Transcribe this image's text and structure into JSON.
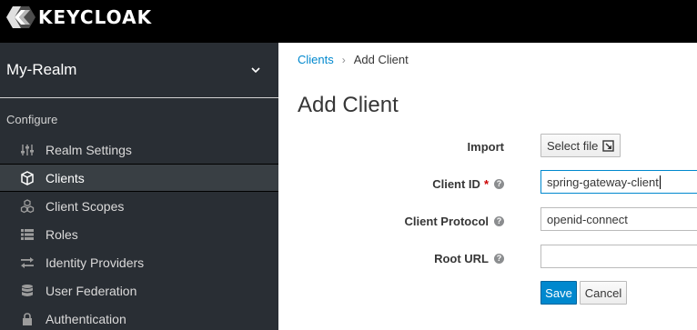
{
  "header": {
    "logo_text": "KEYCLOAK"
  },
  "sidebar": {
    "realm": "My-Realm",
    "section_label": "Configure",
    "items": [
      {
        "label": "Realm Settings",
        "icon": "sliders-icon"
      },
      {
        "label": "Clients",
        "icon": "cube-icon",
        "active": true
      },
      {
        "label": "Client Scopes",
        "icon": "cubes-icon"
      },
      {
        "label": "Roles",
        "icon": "list-icon"
      },
      {
        "label": "Identity Providers",
        "icon": "exchange-icon"
      },
      {
        "label": "User Federation",
        "icon": "database-icon"
      },
      {
        "label": "Authentication",
        "icon": "lock-icon"
      }
    ]
  },
  "breadcrumb": {
    "link": "Clients",
    "separator": "›",
    "current": "Add Client"
  },
  "page_title": "Add Client",
  "form": {
    "import_label": "Import",
    "import_button": "Select file",
    "client_id_label": "Client ID",
    "client_id_required": "*",
    "client_id_value": "spring-gateway-client",
    "client_protocol_label": "Client Protocol",
    "client_protocol_value": "openid-connect",
    "root_url_label": "Root URL",
    "root_url_value": "",
    "help_glyph": "?",
    "save_label": "Save",
    "cancel_label": "Cancel"
  },
  "colors": {
    "header_bg": "#000000",
    "sidebar_bg": "#292e34",
    "accent": "#0088ce",
    "required": "#cc0000"
  }
}
